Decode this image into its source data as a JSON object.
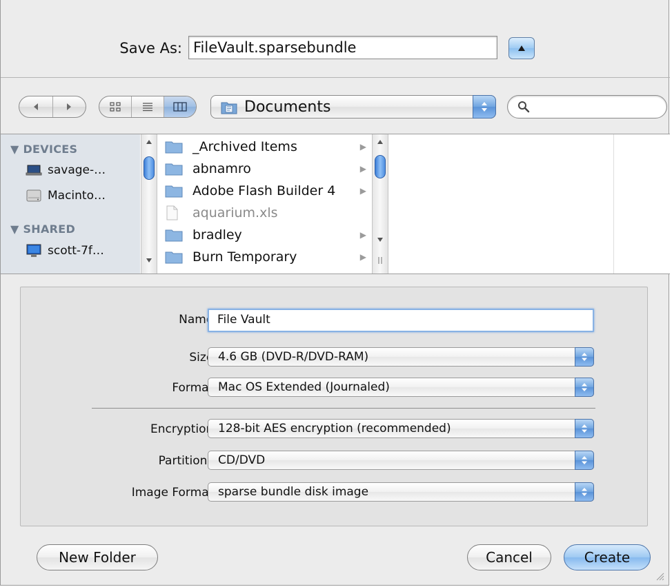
{
  "save_as": {
    "label": "Save As:",
    "value": "FileVault.sparsebundle"
  },
  "toolbar": {
    "location": "Documents",
    "search_placeholder": ""
  },
  "sidebar": {
    "sections": [
      {
        "heading": "▼ DEVICES",
        "items": [
          "savage-…",
          "Macinto…"
        ]
      },
      {
        "heading": "▼ SHARED",
        "items": [
          "scott-7f…"
        ]
      }
    ]
  },
  "files": [
    {
      "name": "_Archived Items",
      "kind": "folder"
    },
    {
      "name": "abnamro",
      "kind": "folder"
    },
    {
      "name": "Adobe Flash Builder 4",
      "kind": "folder"
    },
    {
      "name": "aquarium.xls",
      "kind": "file"
    },
    {
      "name": "bradley",
      "kind": "folder"
    },
    {
      "name": "Burn Temporary",
      "kind": "folder"
    }
  ],
  "options": {
    "name_label": "Name:",
    "name_value": "File Vault",
    "size_label": "Size:",
    "size_value": "4.6 GB (DVD-R/DVD-RAM)",
    "format_label": "Format:",
    "format_value": "Mac OS Extended (Journaled)",
    "encryption_label": "Encryption:",
    "encryption_value": "128-bit AES encryption (recommended)",
    "partitions_label": "Partitions:",
    "partitions_value": "CD/DVD",
    "image_format_label": "Image Format:",
    "image_format_value": "sparse bundle disk image"
  },
  "buttons": {
    "new_folder": "New Folder",
    "cancel": "Cancel",
    "create": "Create"
  },
  "colors": {
    "accent": "#6fa4e0",
    "sidebar_bg": "#dfe4ea",
    "sidebar_heading": "#6f7d8e",
    "dialog_bg": "#ececec"
  }
}
